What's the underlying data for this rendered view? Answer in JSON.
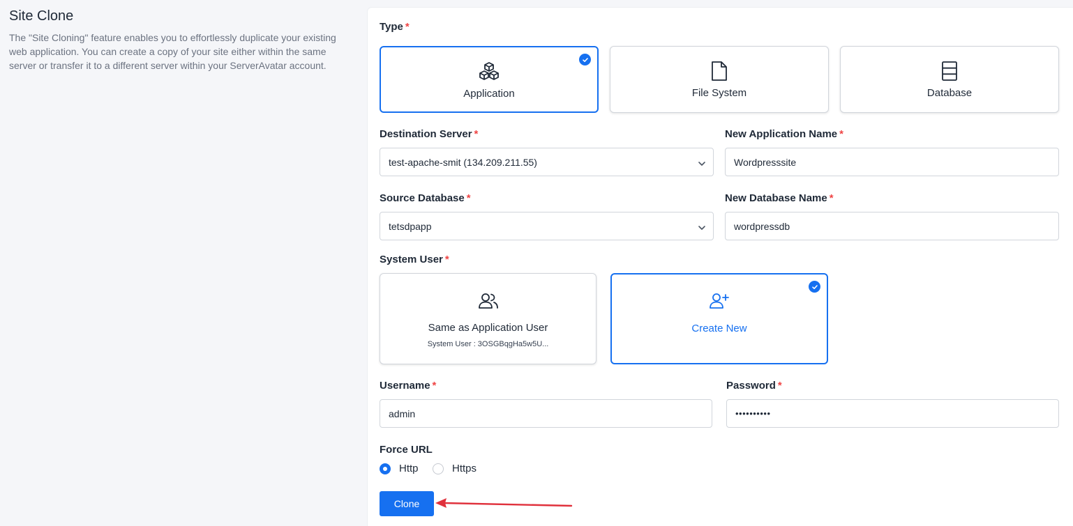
{
  "intro": {
    "title": "Site Clone",
    "description": "The \"Site Cloning\" feature enables you to effortlessly duplicate your existing web application. You can create a copy of your site either within the same server or transfer it to a different server within your ServerAvatar account."
  },
  "type": {
    "label": "Type",
    "options": [
      {
        "label": "Application",
        "icon": "cubes-icon",
        "selected": true
      },
      {
        "label": "File System",
        "icon": "file-icon",
        "selected": false
      },
      {
        "label": "Database",
        "icon": "database-icon",
        "selected": false
      }
    ]
  },
  "destination_server": {
    "label": "Destination Server",
    "value": "test-apache-smit (134.209.211.55)"
  },
  "new_application_name": {
    "label": "New Application Name",
    "value": "Wordpresssite"
  },
  "source_database": {
    "label": "Source Database",
    "value": "tetsdpapp"
  },
  "new_database_name": {
    "label": "New Database Name",
    "value": "wordpressdb"
  },
  "system_user": {
    "label": "System User",
    "same": {
      "label": "Same as Application User",
      "sub": "System User :  3OSGBqgHa5w5U...",
      "selected": false
    },
    "create": {
      "label": "Create New",
      "selected": true
    }
  },
  "username": {
    "label": "Username",
    "value": "admin"
  },
  "password": {
    "label": "Password",
    "value": "••••••••••"
  },
  "force_url": {
    "label": "Force URL",
    "options": [
      {
        "label": "Http",
        "selected": true
      },
      {
        "label": "Https",
        "selected": false
      }
    ]
  },
  "clone_button": {
    "label": "Clone"
  },
  "required_mark": "*",
  "colors": {
    "accent": "#1670f0",
    "required": "#ef4444",
    "arrow": "#e0313c"
  }
}
